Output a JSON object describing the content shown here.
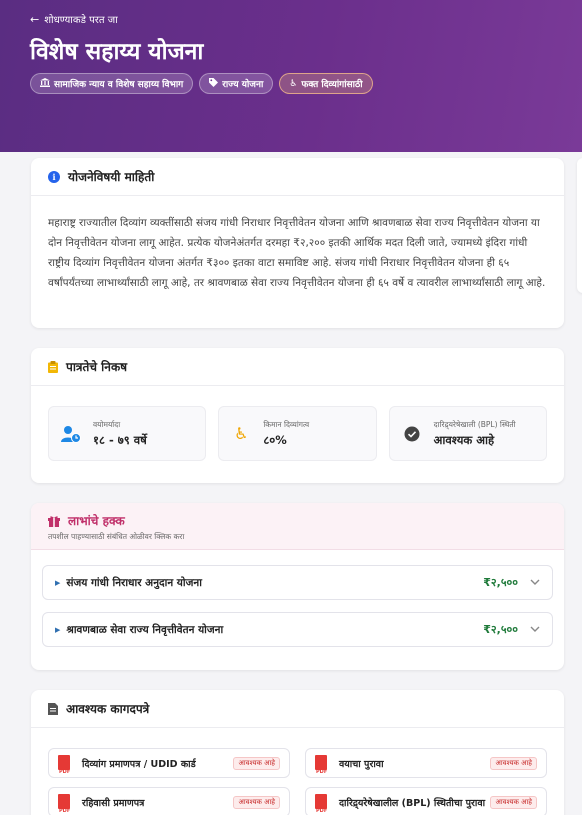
{
  "header": {
    "back_label": "शोधण्याकडे परत जा",
    "title": "विशेष सहाय्य योजना",
    "tags": [
      {
        "label": "सामाजिक न्याय व विशेष सहाय्य विभाग",
        "icon": "bank-icon"
      },
      {
        "label": "राज्य योजना",
        "icon": "tag-icon"
      },
      {
        "label": "फक्त दिव्यांगांसाठी",
        "icon": "wheelchair-icon"
      }
    ]
  },
  "info": {
    "heading": "योजनेविषयी माहिती",
    "description": "महाराष्ट्र राज्यातील दिव्यांग व्यक्तींसाठी संजय गांधी निराधार निवृत्तीवेतन योजना आणि श्रावणबाळ सेवा राज्य निवृत्तीवेतन योजना या दोन निवृत्तीवेतन योजना लागू आहेत. प्रत्येक योजनेअंतर्गत दरमहा ₹२,२०० इतकी आर्थिक मदत दिली जाते, ज्यामध्ये इंदिरा गांधी राष्ट्रीय दिव्यांग निवृत्तीवेतन योजना अंतर्गत ₹३०० इतका वाटा समाविष्ट आहे. संजय गांधी निराधार निवृत्तीवेतन योजना ही ६५ वर्षांपर्यंतच्या लाभार्थ्यांसाठी लागू आहे, तर श्रावणबाळ सेवा राज्य निवृत्तीवेतन योजना ही ६५ वर्षे व त्यावरील लाभार्थ्यांसाठी लागू आहे."
  },
  "eligibility": {
    "heading": "पात्रतेचे निकष",
    "items": [
      {
        "label": "वयोमर्यादा",
        "value": "१८ - ७९ वर्षे",
        "icon": "person-clock-icon"
      },
      {
        "label": "किमान दिव्यांगत्व",
        "value": "८०%",
        "icon": "wheelchair-icon"
      },
      {
        "label": "दारिद्र्यरेषेखाली (BPL) स्थिती",
        "value": "आवश्यक आहे",
        "icon": "check-circle-icon"
      }
    ]
  },
  "benefits": {
    "heading": "लाभांचे हक्क",
    "subtitle": "तपशील पाहण्यासाठी संबंधित ओळीवर क्लिक करा",
    "items": [
      {
        "name": "संजय गांधी निराधार अनुदान योजना",
        "amount": "₹२,५००"
      },
      {
        "name": "श्रावणबाळ सेवा राज्य निवृत्तीवेतन योजना",
        "amount": "₹२,५००"
      }
    ]
  },
  "documents": {
    "heading": "आवश्यक कागदपत्रे",
    "required_label": "आवश्यक आहे",
    "items": [
      {
        "name": "दिव्यांग प्रमाणपत्र / UDID कार्ड"
      },
      {
        "name": "वयाचा पुरावा"
      },
      {
        "name": "रहिवासी प्रमाणपत्र"
      },
      {
        "name": "दारिद्र्यरेषेखालील (BPL) स्थितीचा पुरावा"
      }
    ]
  },
  "colors": {
    "hero_start": "#5a2d82",
    "hero_end": "#7a3a98",
    "accent_pink": "#c0306a",
    "amount_green": "#1f7a3a",
    "required_red": "#c62828"
  }
}
